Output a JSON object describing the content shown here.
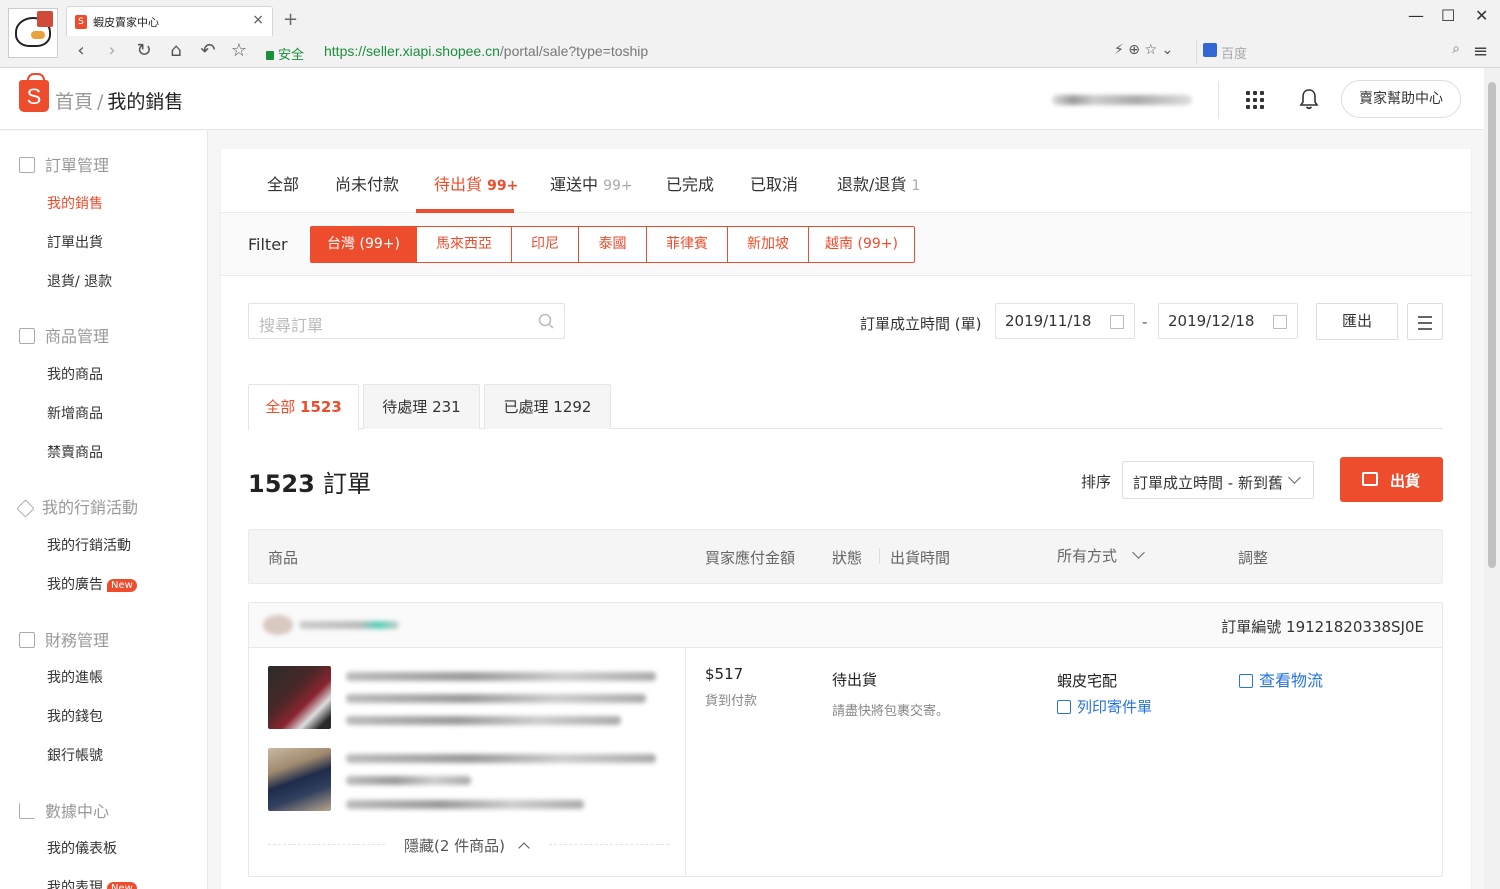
{
  "browser": {
    "tab_title": "蝦皮賣家中心",
    "secure_label": "安全",
    "url_scheme": "https://",
    "url_host": "seller.xiapi.shopee.cn",
    "url_path": "/portal/sale?type=toship",
    "search_placeholder": "百度"
  },
  "header": {
    "logo": "S",
    "crumb_home": "首頁",
    "crumb_sep": "/",
    "crumb_current": "我的銷售",
    "help_button": "賣家幫助中心"
  },
  "sidebar": {
    "sections": [
      {
        "title": "訂單管理",
        "items": [
          "我的銷售",
          "訂單出貨",
          "退貨/ 退款"
        ]
      },
      {
        "title": "商品管理",
        "items": [
          "我的商品",
          "新增商品",
          "禁賣商品"
        ]
      },
      {
        "title": "我的行銷活動",
        "items": [
          "我的行銷活動",
          "我的廣告"
        ]
      },
      {
        "title": "財務管理",
        "items": [
          "我的進帳",
          "我的錢包",
          "銀行帳號"
        ]
      },
      {
        "title": "數據中心",
        "items": [
          "我的儀表板",
          "我的表現"
        ]
      }
    ],
    "new_badge": "New"
  },
  "status_tabs": [
    {
      "label": "全部",
      "count": ""
    },
    {
      "label": "尚未付款",
      "count": ""
    },
    {
      "label": "待出貨",
      "count": "99+"
    },
    {
      "label": "運送中",
      "count": "99+"
    },
    {
      "label": "已完成",
      "count": ""
    },
    {
      "label": "已取消",
      "count": ""
    },
    {
      "label": "退款/退貨",
      "count": "1"
    }
  ],
  "filter": {
    "label": "Filter",
    "chips": [
      "台灣 (99+)",
      "馬來西亞",
      "印尼",
      "泰國",
      "菲律賓",
      "新加坡",
      "越南 (99+)"
    ]
  },
  "search": {
    "placeholder": "搜尋訂單"
  },
  "date_range": {
    "label": "訂單成立時間 (單)",
    "from": "2019/11/18",
    "dash": "-",
    "to": "2019/12/18"
  },
  "export_button": "匯出",
  "sub_tabs": [
    {
      "label": "全部",
      "count": "1523"
    },
    {
      "label": "待處理",
      "count": "231"
    },
    {
      "label": "已處理",
      "count": "1292"
    }
  ],
  "order_count": {
    "number": "1523",
    "unit": "訂單"
  },
  "sort": {
    "label": "排序",
    "value": "訂單成立時間 - 新到舊"
  },
  "ship_button": "出貨",
  "table_headers": {
    "product": "商品",
    "amount": "買家應付金額",
    "status": "狀態",
    "ship_time": "出貨時間",
    "method": "所有方式",
    "action": "調整"
  },
  "order": {
    "order_no_label": "訂單編號",
    "order_no": "19121820338SJ0E",
    "price": "$517",
    "payment": "貨到付款",
    "status": "待出貨",
    "status_note": "請盡快將包裹交寄。",
    "carrier": "蝦皮宅配",
    "print_label": "列印寄件單",
    "track_label": "查看物流",
    "hide_toggle": "隱藏(2 件商品)"
  },
  "colors": {
    "accent": "#ee4d2d",
    "link": "#2673dd"
  }
}
